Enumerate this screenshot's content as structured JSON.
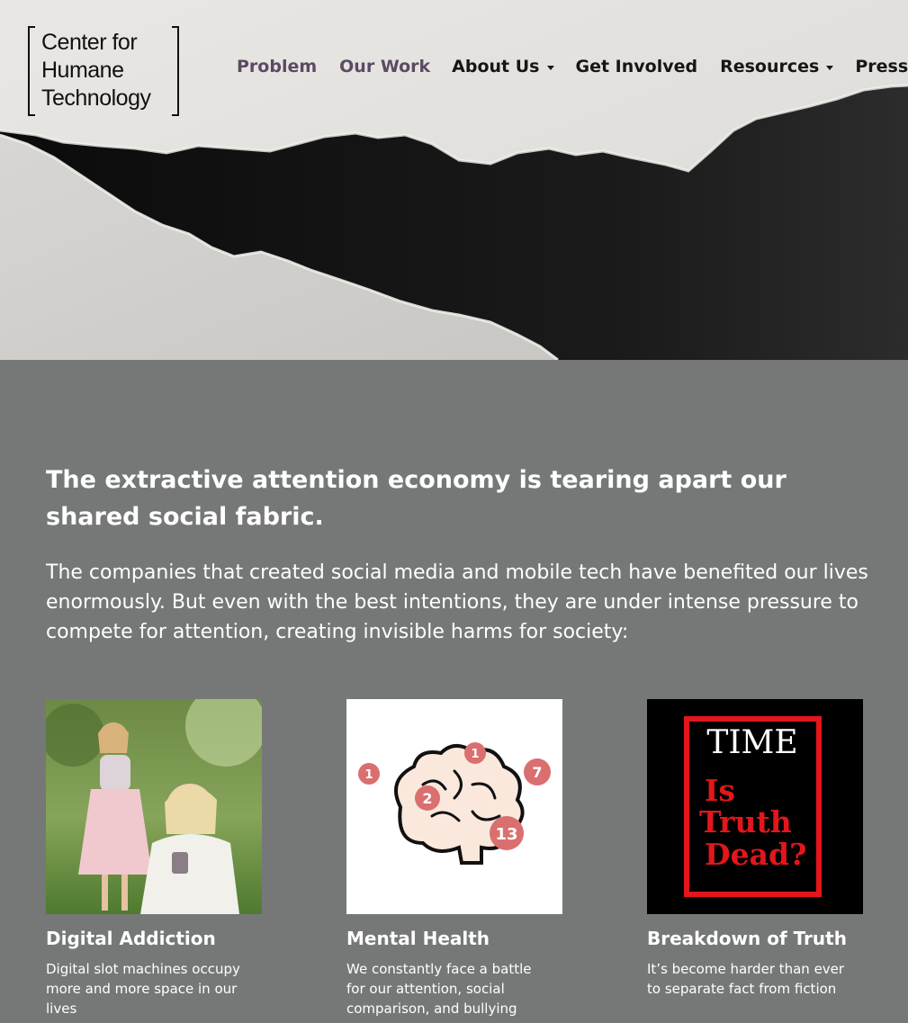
{
  "logo": {
    "lines": [
      "Center for",
      "Humane",
      "Technology"
    ]
  },
  "nav": [
    {
      "label": "Problem",
      "has_dropdown": false,
      "muted": true
    },
    {
      "label": "Our Work",
      "has_dropdown": false,
      "muted": true
    },
    {
      "label": "About Us",
      "has_dropdown": true,
      "muted": false
    },
    {
      "label": "Get Involved",
      "has_dropdown": false,
      "muted": false
    },
    {
      "label": "Resources",
      "has_dropdown": true,
      "muted": false
    },
    {
      "label": "Press",
      "has_dropdown": true,
      "muted": false
    }
  ],
  "main": {
    "headline": "The extractive attention economy is tearing apart our shared social fabric.",
    "intro": "The companies that created social media and mobile tech have benefited our lives enormously. But even with the best intentions, they are under intense pressure to compete for attention, creating invisible harms for society:"
  },
  "cards": [
    {
      "title": "Digital Addiction",
      "text": "Digital slot machines occupy more and more space in our lives"
    },
    {
      "title": "Mental Health",
      "text": "We constantly face a battle for our attention, social comparison, and bullying",
      "badges": [
        "1",
        "1",
        "7",
        "2",
        "13"
      ]
    },
    {
      "title": "Breakdown of Truth",
      "text": "It’s become harder than ever to separate fact from fiction",
      "cover": {
        "masthead": "TIME",
        "lines": [
          "Is",
          "Truth",
          "Dead?"
        ]
      }
    }
  ],
  "colors": {
    "nav_muted": "#5b4a63",
    "content_bg": "#757877",
    "badge": "#d9706f",
    "time_red": "#e3161b"
  }
}
